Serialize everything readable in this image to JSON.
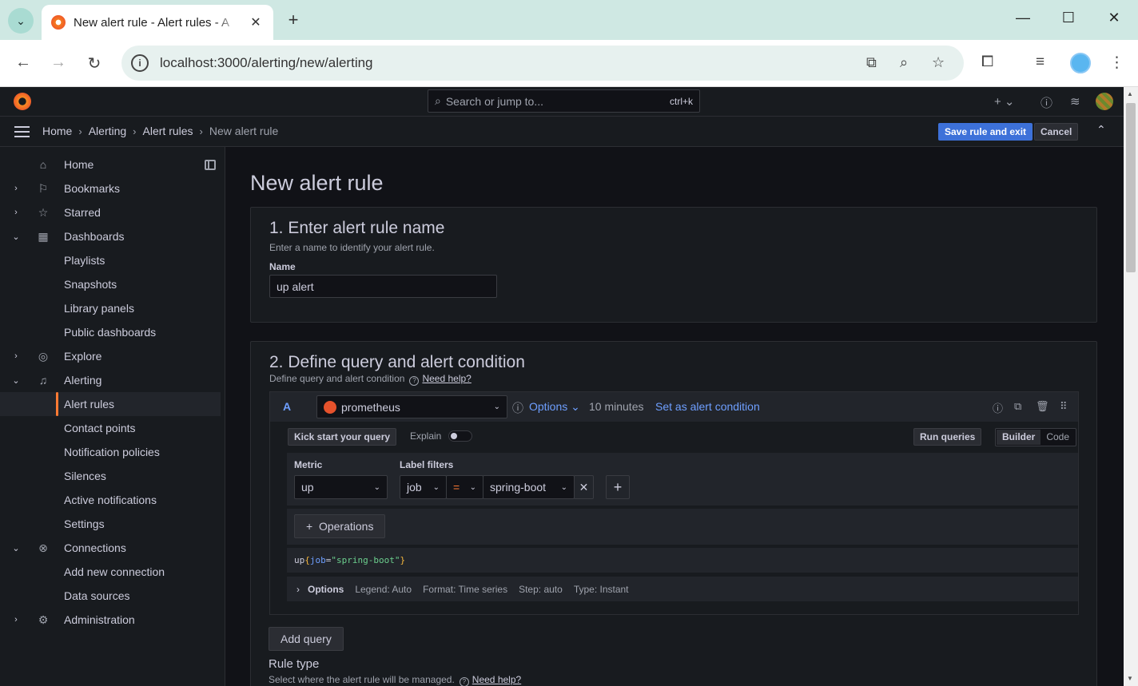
{
  "browser": {
    "tab_title": "New alert rule - Alert rules - A",
    "url": "localhost:3000/alerting/new/alerting"
  },
  "topbar": {
    "search_placeholder": "Search or jump to...",
    "search_shortcut": "ctrl+k"
  },
  "breadcrumb": [
    "Home",
    "Alerting",
    "Alert rules",
    "New alert rule"
  ],
  "actions": {
    "save": "Save rule and exit",
    "cancel": "Cancel"
  },
  "sidebar": {
    "items": [
      {
        "label": "Home",
        "icon": "home-icon",
        "chevron": ""
      },
      {
        "label": "Bookmarks",
        "icon": "bookmark-icon",
        "chevron": "›"
      },
      {
        "label": "Starred",
        "icon": "star-icon",
        "chevron": "›"
      },
      {
        "label": "Dashboards",
        "icon": "dashboards-icon",
        "chevron": "⌄"
      },
      {
        "label": "Playlists",
        "icon": "",
        "chevron": ""
      },
      {
        "label": "Snapshots",
        "icon": "",
        "chevron": ""
      },
      {
        "label": "Library panels",
        "icon": "",
        "chevron": ""
      },
      {
        "label": "Public dashboards",
        "icon": "",
        "chevron": ""
      },
      {
        "label": "Explore",
        "icon": "compass-icon",
        "chevron": "›"
      },
      {
        "label": "Alerting",
        "icon": "bell-icon",
        "chevron": "⌄"
      },
      {
        "label": "Alert rules",
        "icon": "",
        "chevron": "",
        "active": true
      },
      {
        "label": "Contact points",
        "icon": "",
        "chevron": ""
      },
      {
        "label": "Notification policies",
        "icon": "",
        "chevron": ""
      },
      {
        "label": "Silences",
        "icon": "",
        "chevron": ""
      },
      {
        "label": "Active notifications",
        "icon": "",
        "chevron": ""
      },
      {
        "label": "Settings",
        "icon": "",
        "chevron": ""
      },
      {
        "label": "Connections",
        "icon": "connections-icon",
        "chevron": "⌄"
      },
      {
        "label": "Add new connection",
        "icon": "",
        "chevron": ""
      },
      {
        "label": "Data sources",
        "icon": "",
        "chevron": ""
      },
      {
        "label": "Administration",
        "icon": "cog-icon",
        "chevron": "›"
      }
    ]
  },
  "main": {
    "title": "New alert rule",
    "section1": {
      "title": "1. Enter alert rule name",
      "subtitle": "Enter a name to identify your alert rule.",
      "name_label": "Name",
      "name_value": "up alert"
    },
    "section2": {
      "title": "2. Define query and alert condition",
      "subtitle": "Define query and alert condition",
      "help": "Need help?",
      "query": {
        "ref": "A",
        "datasource": "prometheus",
        "options_label": "Options",
        "interval": "10 minutes",
        "set_condition": "Set as alert condition",
        "kick_start": "Kick start your query",
        "explain": "Explain",
        "run_queries": "Run queries",
        "mode_builder": "Builder",
        "mode_code": "Code",
        "metric_label": "Metric",
        "metric_value": "up",
        "label_filters_label": "Label filters",
        "filter_key": "job",
        "filter_op": "=",
        "filter_value": "spring-boot",
        "operations": "Operations",
        "preview_metric": "up",
        "preview_open": "{",
        "preview_label": "job",
        "preview_op": "=",
        "preview_value": "\"spring-boot\"",
        "preview_close": "}",
        "opts_title": "Options",
        "opts_legend": "Legend: Auto",
        "opts_format": "Format: Time series",
        "opts_step": "Step: auto",
        "opts_type": "Type: Instant"
      },
      "add_query": "Add query",
      "rule_type_title": "Rule type",
      "rule_type_sub": "Select where the alert rule will be managed.",
      "rule_type_help": "Need help?"
    }
  }
}
